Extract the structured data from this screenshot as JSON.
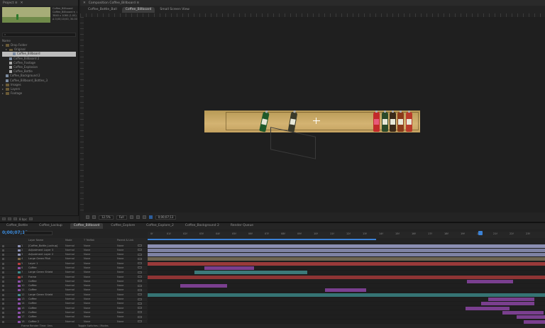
{
  "project": {
    "tab_label": "Project ≡",
    "thumb_title": "Coffee_Billboard",
    "meta_lines": [
      "Coffee_Billboard ▾, used 1 time",
      "3840 x 1080 (1.00)",
      "Δ 0;00;10;00, 30.00 fps"
    ],
    "search_placeholder": "⌕",
    "col_name": "Name",
    "tree": [
      {
        "indent": 0,
        "type": "folder",
        "label": "Drop Folder"
      },
      {
        "indent": 1,
        "type": "folder",
        "label": "Original"
      },
      {
        "indent": 2,
        "type": "comp",
        "label": "Coffee_Billboard",
        "selected": true
      },
      {
        "indent": 1,
        "type": "comp",
        "label": "Coffee_Billboard 2"
      },
      {
        "indent": 1,
        "type": "solid",
        "label": "Coffee_Footage"
      },
      {
        "indent": 1,
        "type": "solid",
        "label": "Coffee_Explosion"
      },
      {
        "indent": 1,
        "type": "solid",
        "label": "Coffee_Bottle"
      },
      {
        "indent": 0,
        "type": "comp",
        "label": "Coffee_Background 2"
      },
      {
        "indent": 0,
        "type": "comp",
        "label": "Coffee_Billboard_Bottles_3"
      },
      {
        "indent": 0,
        "type": "folder",
        "label": "Images"
      },
      {
        "indent": 0,
        "type": "folder",
        "label": "Layers"
      },
      {
        "indent": 0,
        "type": "folder",
        "label": "Footage"
      }
    ],
    "bpc": "8 bpc"
  },
  "composition": {
    "panel_title": "Composition Coffee_Billboard ≡",
    "tabs": [
      "Coffee_Bottle_Ball",
      "Coffee_Billboard",
      "Small Screen View"
    ],
    "active_tab": 1,
    "toolbar": {
      "zoom": "12.5%",
      "quality": "Full",
      "timecode": "0;00;07;13"
    }
  },
  "timeline": {
    "tabs": [
      "Coffee_Bottle",
      "Coffee_Lockup",
      "Coffee_Billboard",
      "Coffee_Explore",
      "Coffee_Explore_2",
      "Coffee_Background 2",
      "Render Queue"
    ],
    "active_tab": 2,
    "timecode": "0;00;07;13",
    "columns": [
      "Layer Name",
      "Mode",
      "T TrkMat",
      "Parent & Link"
    ],
    "layers": [
      {
        "num": "1",
        "name": "[Coffee_Bottle_Lockup]",
        "mode": "Normal",
        "trk": "None",
        "parent": "None",
        "color": "#8b8fb3"
      },
      {
        "num": "2",
        "name": "Adjustment Layer 3",
        "mode": "Normal",
        "trk": "None",
        "parent": "None",
        "color": "#8b8fb3"
      },
      {
        "num": "3",
        "name": "Adjustment Layer 2",
        "mode": "Normal",
        "trk": "None",
        "parent": "None",
        "color": "#8b8fb3"
      },
      {
        "num": "4",
        "name": "Large Green Pilot",
        "mode": "Normal",
        "trk": "None",
        "parent": "None",
        "color": "#7a6a4a"
      },
      {
        "num": "5",
        "name": "Layer 1",
        "mode": "Normal",
        "trk": "None",
        "parent": "None",
        "color": "#b44040"
      },
      {
        "num": "6",
        "name": "Coffee",
        "mode": "Normal",
        "trk": "None",
        "parent": "None",
        "color": "#8b4fa8"
      },
      {
        "num": "7",
        "name": "Large Green Shield",
        "mode": "Normal",
        "trk": "None",
        "parent": "None",
        "color": "#3f8a8a"
      },
      {
        "num": "8",
        "name": "Frame",
        "mode": "Normal",
        "trk": "None",
        "parent": "None",
        "color": "#b44040"
      },
      {
        "num": "9",
        "name": "Coffee",
        "mode": "Normal",
        "trk": "None",
        "parent": "None",
        "color": "#8b4fa8"
      },
      {
        "num": "10",
        "name": "Coffee",
        "mode": "Normal",
        "trk": "None",
        "parent": "None",
        "color": "#8b4fa8"
      },
      {
        "num": "11",
        "name": "Coffee",
        "mode": "Normal",
        "trk": "None",
        "parent": "None",
        "color": "#8b4fa8"
      },
      {
        "num": "12",
        "name": "Large Green Shield",
        "mode": "Normal",
        "trk": "None",
        "parent": "None",
        "color": "#3f8a8a"
      },
      {
        "num": "13",
        "name": "Coffee",
        "mode": "Normal",
        "trk": "None",
        "parent": "None",
        "color": "#8b4fa8"
      },
      {
        "num": "14",
        "name": "Coffee",
        "mode": "Normal",
        "trk": "None",
        "parent": "None",
        "color": "#8b4fa8"
      },
      {
        "num": "15",
        "name": "Coffee",
        "mode": "Normal",
        "trk": "None",
        "parent": "None",
        "color": "#8b4fa8"
      },
      {
        "num": "16",
        "name": "Coffee",
        "mode": "Normal",
        "trk": "None",
        "parent": "None",
        "color": "#8b4fa8"
      },
      {
        "num": "17",
        "name": "Coffee",
        "mode": "Normal",
        "trk": "None",
        "parent": "None",
        "color": "#8b4fa8"
      },
      {
        "num": "18",
        "name": "Coffee 2",
        "mode": "Normal",
        "trk": "None",
        "parent": "None",
        "color": "#8b4fa8"
      }
    ],
    "ruler_labels": [
      "0f",
      "01f",
      "02f",
      "03f",
      "04f",
      "05f",
      "06f",
      "07f",
      "08f",
      "09f",
      "10f",
      "11f",
      "12f",
      "13f",
      "14f",
      "15f",
      "16f",
      "17f",
      "18f",
      "19f",
      "20f",
      "21f",
      "22f",
      "23f"
    ],
    "footer": {
      "left": "Frame Render Time: 0ms",
      "mid": "Toggle Switches / Modes"
    }
  }
}
